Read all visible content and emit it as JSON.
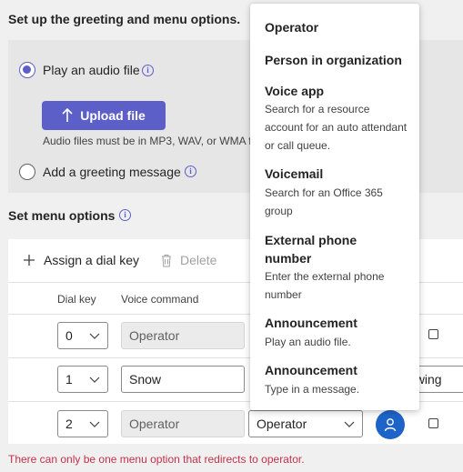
{
  "greeting": {
    "heading": "Set up the greeting and menu options.",
    "play_audio_label": "Play an audio file",
    "upload_button_label": "Upload file",
    "audio_hint": "Audio files must be in MP3, WAV, or WMA f",
    "add_greeting_label": "Add a greeting message"
  },
  "menu": {
    "heading": "Set menu options",
    "assign_label": "Assign a dial key",
    "delete_label": "Delete",
    "columns": {
      "dial_key": "Dial key",
      "voice_command": "Voice command"
    },
    "rows": [
      {
        "dial_key": "0",
        "voice_command": "Operator",
        "voice_disabled": true,
        "trailing": ""
      },
      {
        "dial_key": "1",
        "voice_command": "Snow",
        "voice_disabled": false,
        "trailing": "owing"
      },
      {
        "dial_key": "2",
        "voice_command": "Operator",
        "voice_disabled": true,
        "redirect": "Operator"
      }
    ],
    "error_text": "There can only be one menu option that redirects to operator."
  },
  "popup": {
    "options": [
      {
        "title": "Operator",
        "desc": ""
      },
      {
        "title": "Person in organization",
        "desc": ""
      },
      {
        "title": "Voice app",
        "desc": "Search for a resource account for an auto attendant or call queue."
      },
      {
        "title": "Voicemail",
        "desc": "Search for an Office 365 group"
      },
      {
        "title": "External phone number",
        "desc": "Enter the external phone number"
      },
      {
        "title": "Announcement",
        "desc": "Play an audio file."
      },
      {
        "title": "Announcement",
        "desc": "Type in a message."
      }
    ]
  },
  "colors": {
    "accent": "#5b5fc7",
    "error": "#c4314b",
    "avatar": "#1e64c8"
  },
  "icons": {
    "upload": "arrow-up-icon",
    "info": "info-icon",
    "add": "plus-icon",
    "delete": "trash-icon",
    "chevron": "chevron-down-icon",
    "person": "person-icon"
  }
}
